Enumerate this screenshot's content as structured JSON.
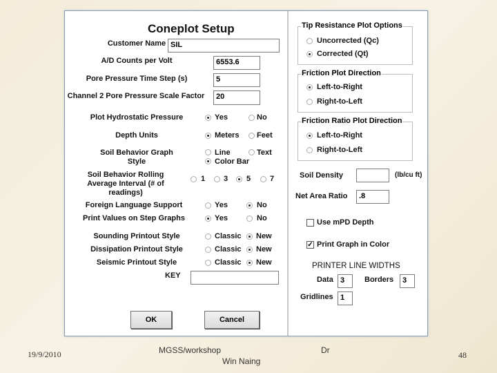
{
  "dialog": {
    "title": "Coneplot Setup"
  },
  "fields": {
    "customer_name": {
      "label": "Customer Name",
      "value": "SIL"
    },
    "ad_counts": {
      "label": "A/D Counts per Volt",
      "value": "6553.6"
    },
    "pore_time_step": {
      "label": "Pore Pressure Time Step (s)",
      "value": "5"
    },
    "ch2_scale": {
      "label": "Channel 2 Pore Pressure Scale Factor",
      "value": "20"
    },
    "key": {
      "label": "KEY",
      "value": ""
    }
  },
  "options": {
    "hydro": {
      "label": "Plot Hydrostatic Pressure",
      "opts": [
        "Yes",
        "No"
      ],
      "selected": "Yes"
    },
    "depth": {
      "label": "Depth Units",
      "opts": [
        "Meters",
        "Feet"
      ],
      "selected": "Meters"
    },
    "sbg": {
      "label1": "Soil Behavior Graph",
      "label2": "Style",
      "opts": [
        "Line",
        "Text",
        "Color Bar"
      ],
      "selected": "Color Bar"
    },
    "rolling": {
      "label1": "Soil Behavior Rolling",
      "label2": "Average Interval (# of",
      "label3": "readings)",
      "opts": [
        "1",
        "3",
        "5",
        "7"
      ],
      "selected": "5"
    },
    "foreign": {
      "label": "Foreign Language Support",
      "opts": [
        "Yes",
        "No"
      ],
      "selected": "No"
    },
    "printvals": {
      "label": "Print Values on Step Graphs",
      "opts": [
        "Yes",
        "No"
      ],
      "selected": "Yes"
    },
    "sounding": {
      "label": "Sounding Printout Style",
      "opts": [
        "Classic",
        "New"
      ],
      "selected": "New"
    },
    "dissipation": {
      "label": "Dissipation Printout Style",
      "opts": [
        "Classic",
        "New"
      ],
      "selected": "New"
    },
    "seismic": {
      "label": "Seismic Printout Style",
      "opts": [
        "Classic",
        "New"
      ],
      "selected": "New"
    }
  },
  "buttons": {
    "ok": "OK",
    "cancel": "Cancel"
  },
  "right": {
    "tip": {
      "title": "Tip Resistance Plot Options",
      "opts": [
        "Uncorrected (Qc)",
        "Corrected (Qt)"
      ],
      "selected": "Corrected (Qt)"
    },
    "friction": {
      "title": "Friction Plot Direction",
      "opts": [
        "Left-to-Right",
        "Right-to-Left"
      ],
      "selected": "Left-to-Right"
    },
    "fratio": {
      "title": "Friction Ratio Plot Direction",
      "opts": [
        "Left-to-Right",
        "Right-to-Left"
      ],
      "selected": "Left-to-Right"
    },
    "soil_density": {
      "label": "Soil Density",
      "value": "",
      "unit": "(lb/cu ft)"
    },
    "net_area": {
      "label": "Net Area Ratio",
      "value": ".8"
    },
    "mpd": {
      "label": "Use mPD Depth",
      "checked": false
    },
    "color": {
      "label": "Print Graph in Color",
      "checked": true
    },
    "plw": {
      "title": "PRINTER LINE WIDTHS",
      "data_label": "Data",
      "data": "3",
      "borders_label": "Borders",
      "borders": "3",
      "grid_label": "Gridlines",
      "grid": "1"
    }
  },
  "footer": {
    "date": "19/9/2010",
    "workshop": "MGSS/workshop",
    "dr": "Dr",
    "name": "Win Naing",
    "page": "48"
  }
}
